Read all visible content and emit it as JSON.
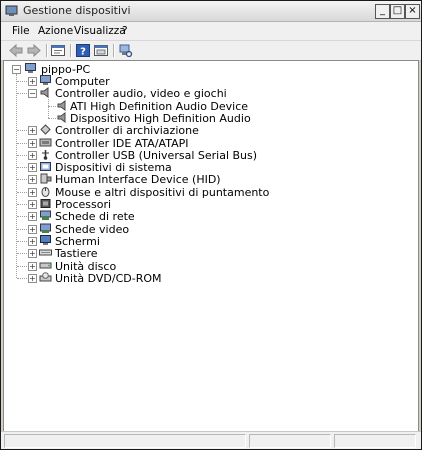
{
  "window": {
    "title": "Gestione dispositivi"
  },
  "title_buttons": {
    "minimize": "_",
    "maximize": "□",
    "close": "×"
  },
  "menu": [
    "File",
    "Azione",
    "Visualizza",
    "?"
  ],
  "toolbar_icons": [
    "back-arrow-icon",
    "forward-arrow-icon",
    "properties-icon",
    "help-icon",
    "show-hidden-icon",
    "scan-hardware-icon"
  ],
  "tree": {
    "root": "pippo-PC",
    "categories": [
      {
        "label": "Computer",
        "icon": "computer-icon",
        "expanded": false
      },
      {
        "label": "Controller audio, video e giochi",
        "icon": "speaker-icon",
        "expanded": true,
        "children": [
          "ATI High Definition Audio Device",
          "Dispositivo High Definition Audio"
        ]
      },
      {
        "label": "Controller di archiviazione",
        "icon": "storage-controller-icon",
        "expanded": false
      },
      {
        "label": "Controller IDE ATA/ATAPI",
        "icon": "ide-controller-icon",
        "expanded": false
      },
      {
        "label": "Controller USB (Universal Serial Bus)",
        "icon": "usb-icon",
        "expanded": false
      },
      {
        "label": "Dispositivi di sistema",
        "icon": "system-device-icon",
        "expanded": false
      },
      {
        "label": "Human Interface Device (HID)",
        "icon": "hid-icon",
        "expanded": false
      },
      {
        "label": "Mouse e altri dispositivi di puntamento",
        "icon": "mouse-icon",
        "expanded": false
      },
      {
        "label": "Processori",
        "icon": "processor-icon",
        "expanded": false
      },
      {
        "label": "Schede di rete",
        "icon": "network-card-icon",
        "expanded": false
      },
      {
        "label": "Schede video",
        "icon": "video-card-icon",
        "expanded": false
      },
      {
        "label": "Schermi",
        "icon": "monitor-icon",
        "expanded": false
      },
      {
        "label": "Tastiere",
        "icon": "keyboard-icon",
        "expanded": false
      },
      {
        "label": "Unità disco",
        "icon": "disk-drive-icon",
        "expanded": false
      },
      {
        "label": "Unità DVD/CD-ROM",
        "icon": "dvd-drive-icon",
        "expanded": false
      }
    ]
  },
  "expand_symbols": {
    "collapsed": "+",
    "expanded": "−"
  }
}
